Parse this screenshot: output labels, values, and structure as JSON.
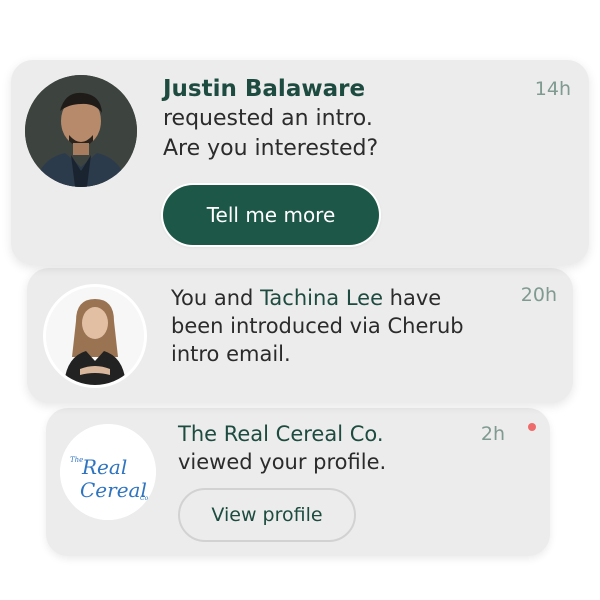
{
  "notifications": [
    {
      "name": "Justin Balaware",
      "message_line1": "requested an intro.",
      "message_line2": "Are you interested?",
      "time": "14h",
      "action_label": "Tell me more"
    },
    {
      "line1_prefix": "You and ",
      "line1_highlight": "Tachina Lee",
      "line1_suffix": " have",
      "line2": "been introduced via Cherub",
      "line3": "intro email.",
      "time": "20h"
    },
    {
      "company": "The Real Cereal Co.",
      "message": "viewed your profile.",
      "time": "2h",
      "action_label": "View profile",
      "logo_small": "The",
      "logo_word1": "Real",
      "logo_word2": "Cereal",
      "logo_suffix": "Co.",
      "unread": true
    }
  ],
  "colors": {
    "accent": "#1d5747",
    "card_bg": "#ececec",
    "time_text": "#7f9a90",
    "unread_dot": "#ef6b6b",
    "logo_blue": "#2f74c0"
  }
}
